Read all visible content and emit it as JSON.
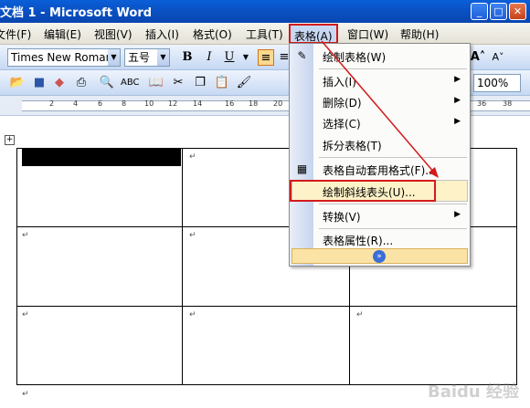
{
  "window": {
    "title": "文档 1 - Microsoft Word",
    "minimize": "_",
    "maximize": "□",
    "close": "✕"
  },
  "menubar": {
    "items": [
      {
        "label": "文件(F)"
      },
      {
        "label": "编辑(E)"
      },
      {
        "label": "视图(V)"
      },
      {
        "label": "插入(I)"
      },
      {
        "label": "格式(O)"
      },
      {
        "label": "工具(T)"
      },
      {
        "label": "表格(A)"
      },
      {
        "label": "窗口(W)"
      },
      {
        "label": "帮助(H)"
      }
    ]
  },
  "toolbar": {
    "font_name": "Times New Roman",
    "font_size": "五号",
    "bold": "B",
    "italic": "I",
    "underline": "U",
    "zoom": "100%"
  },
  "ruler": {
    "numbers": [
      "2",
      "4",
      "6",
      "8",
      "10",
      "12",
      "14",
      "16",
      "18",
      "20",
      "36",
      "38"
    ]
  },
  "table_menu": {
    "items": [
      {
        "label": "绘制表格(W)",
        "icon": "pencil-icon"
      },
      {
        "label": "插入(I)",
        "submenu": "▶"
      },
      {
        "label": "删除(D)",
        "submenu": "▶"
      },
      {
        "label": "选择(C)",
        "submenu": "▶"
      },
      {
        "label": "拆分表格(T)"
      },
      {
        "label": "表格自动套用格式(F)...",
        "icon": "autoformat-icon"
      },
      {
        "label": "绘制斜线表头(U)..."
      },
      {
        "label": "转换(V)",
        "submenu": "▶"
      },
      {
        "label": "表格属性(R)..."
      }
    ],
    "expand": "»"
  },
  "document": {
    "cell_mark": "↵",
    "watermark": "Baidu 经验"
  },
  "colors": {
    "highlight_box": "#d31a1a",
    "title_bar": "#0a4fc0",
    "menu_highlight": "#fdf2c8"
  }
}
